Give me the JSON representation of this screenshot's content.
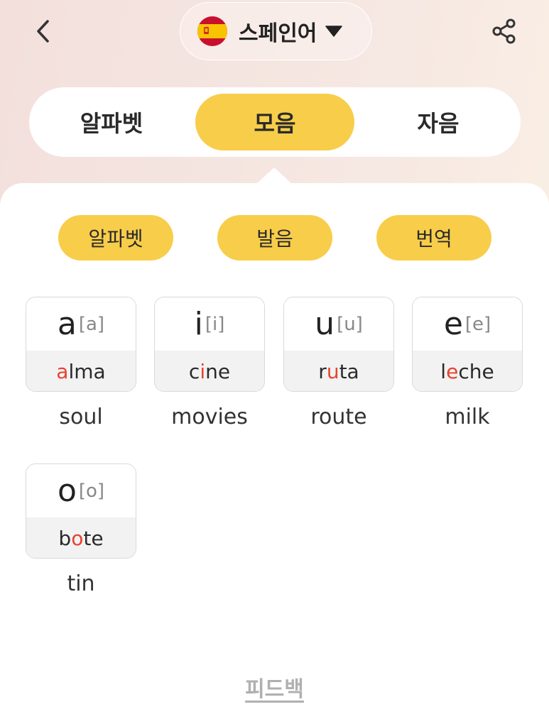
{
  "header": {
    "back_icon": "chevron-left-icon",
    "language": "스페인어",
    "flag_icon": "spain-flag-icon",
    "caret_icon": "caret-down-icon",
    "share_icon": "share-icon"
  },
  "tabs": [
    {
      "label": "알파벳",
      "active": false
    },
    {
      "label": "모음",
      "active": true
    },
    {
      "label": "자음",
      "active": false
    }
  ],
  "filters": [
    {
      "label": "알파벳"
    },
    {
      "label": "발음"
    },
    {
      "label": "번역"
    }
  ],
  "vowels": [
    {
      "letter": "a",
      "ipa": "[a]",
      "word_pre": "",
      "word_hl": "a",
      "word_post": "lma",
      "meaning": "soul"
    },
    {
      "letter": "i",
      "ipa": "[i]",
      "word_pre": "c",
      "word_hl": "i",
      "word_post": "ne",
      "meaning": "movies"
    },
    {
      "letter": "u",
      "ipa": "[u]",
      "word_pre": "r",
      "word_hl": "u",
      "word_post": "ta",
      "meaning": "route"
    },
    {
      "letter": "e",
      "ipa": "[e]",
      "word_pre": "l",
      "word_hl": "e",
      "word_post": "che",
      "meaning": "milk"
    },
    {
      "letter": "o",
      "ipa": "[o]",
      "word_pre": "b",
      "word_hl": "o",
      "word_post": "te",
      "meaning": "tin"
    }
  ],
  "feedback_label": "피드백",
  "colors": {
    "accent": "#f8cd4a",
    "highlight": "#e8432e",
    "background": "#f3e0dd"
  }
}
